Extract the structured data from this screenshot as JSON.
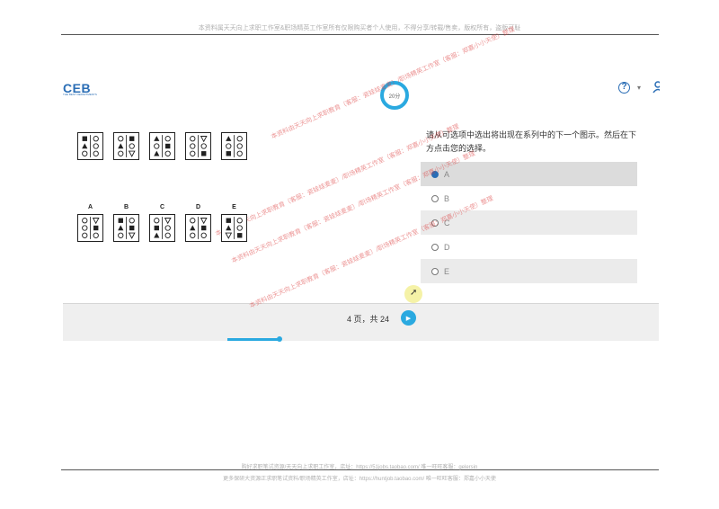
{
  "doc": {
    "top_note": "本资料属天天向上求职工作室&职场精英工作室所有仅限购买者个人使用，不得分享/转载/售卖，版权所有，盗版可耻",
    "footer_line1": "购好求职笔试资源/天天向上求职工作室，店址：https://51jobs.taobao.com/ 唯一旺旺客服：gelersin",
    "footer_line2": "更多保研大资源正求职笔试资料/职场精英工作室，店址：https://huntjob.taobao.com/ 唯一旺旺客服：郑嘉小小天使"
  },
  "app": {
    "logo": "CEB",
    "logo_sub": "THE BEST DEPARTMENTS",
    "timer": "20分",
    "help_icon": "?",
    "help_caret": "▾"
  },
  "puzzle": {
    "series": [
      {
        "shapes": [
          "square",
          "circle",
          "triangle",
          "circle",
          "circle",
          "circle"
        ]
      },
      {
        "shapes": [
          "circle",
          "square",
          "triangle",
          "circle",
          "circle",
          "tri-down"
        ]
      },
      {
        "shapes": [
          "triangle",
          "circle",
          "circle",
          "square",
          "triangle",
          "circle"
        ]
      },
      {
        "shapes": [
          "circle",
          "tri-down",
          "circle",
          "circle",
          "circle",
          "square"
        ]
      },
      {
        "shapes": [
          "triangle",
          "circle",
          "circle",
          "circle",
          "square",
          "circle"
        ]
      }
    ],
    "answers": [
      {
        "label": "A",
        "shapes": [
          "circle",
          "tri-down",
          "circle",
          "square",
          "circle",
          "circle"
        ]
      },
      {
        "label": "B",
        "shapes": [
          "square",
          "circle",
          "triangle",
          "square",
          "circle",
          "tri-down"
        ]
      },
      {
        "label": "C",
        "shapes": [
          "circle",
          "tri-down",
          "square",
          "circle",
          "triangle",
          "circle"
        ]
      },
      {
        "label": "D",
        "shapes": [
          "circle",
          "tri-down",
          "triangle",
          "square",
          "circle",
          "circle"
        ]
      },
      {
        "label": "E",
        "shapes": [
          "square",
          "circle",
          "triangle",
          "circle",
          "tri-down",
          "square"
        ]
      }
    ]
  },
  "question": {
    "text": "请从可选项中选出将出现在系列中的下一个图示。然后在下方点击您的选择。"
  },
  "options": [
    {
      "label": "A",
      "selected": true
    },
    {
      "label": "B",
      "selected": false
    },
    {
      "label": "C",
      "selected": false
    },
    {
      "label": "D",
      "selected": false
    },
    {
      "label": "E",
      "selected": false
    }
  ],
  "footer": {
    "page_text": "4 页，共 24",
    "next_icon": "▶",
    "progress_fraction": 0.17
  },
  "watermarks": [
    "本资料由天天向上求职教育（客服：瓷娃娃麦麦）/职场精英工作室（客服：郑嘉小小天使）整理",
    "本资料由天天向上求职教育（客服：瓷娃娃麦麦）/职场精英工作室（客服：郑嘉小小天使）整理",
    "本资料由天天向上求职教育（客服：瓷娃娃麦麦）/职场精英工作室（客服：郑嘉小小天使）整理",
    "本资料由天天向上求职教育（客服：瓷娃娃麦麦）/职场精英工作室（客服：郑嘉小小天使）整理"
  ]
}
